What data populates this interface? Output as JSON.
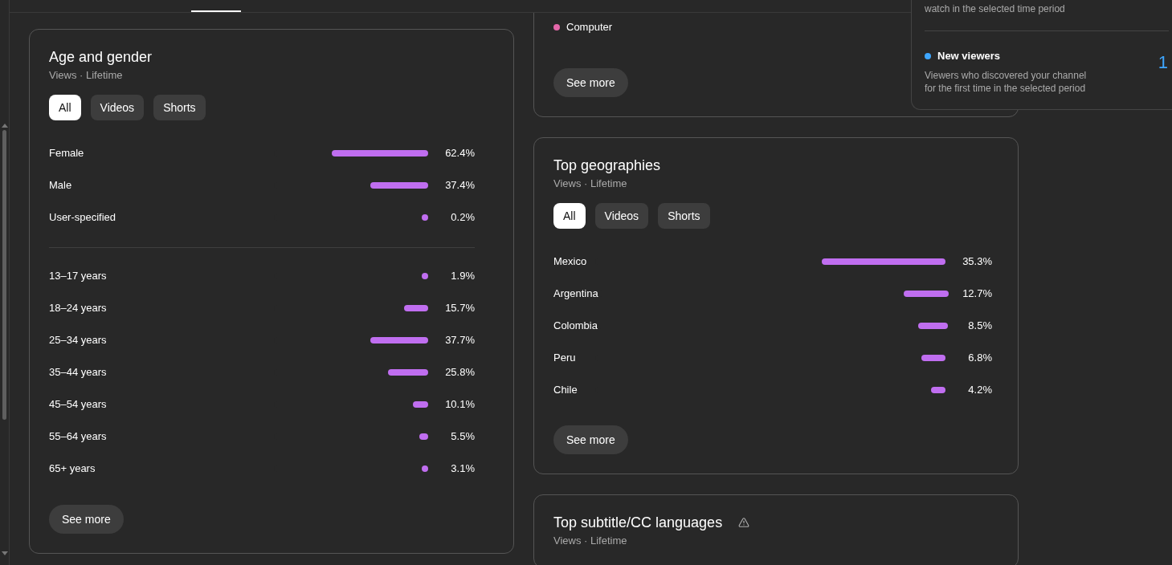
{
  "device_card": {
    "legend": [
      {
        "label": "Computer",
        "color": "#e467a9"
      }
    ],
    "button": "See more"
  },
  "age_gender": {
    "title": "Age and gender",
    "subtitle": "Views · Lifetime",
    "filters": [
      {
        "label": "All",
        "selected": true
      },
      {
        "label": "Videos",
        "selected": false
      },
      {
        "label": "Shorts",
        "selected": false
      }
    ],
    "gender": [
      {
        "label": "Female",
        "value": "62.4%",
        "level": 0.624
      },
      {
        "label": "Male",
        "value": "37.4%",
        "level": 0.374
      },
      {
        "label": "User-specified",
        "value": "0.2%",
        "level": 0.002
      }
    ],
    "age": [
      {
        "label": "13–17 years",
        "value": "1.9%",
        "level": 0.019
      },
      {
        "label": "18–24 years",
        "value": "15.7%",
        "level": 0.157
      },
      {
        "label": "25–34 years",
        "value": "37.7%",
        "level": 0.377
      },
      {
        "label": "35–44 years",
        "value": "25.8%",
        "level": 0.258
      },
      {
        "label": "45–54 years",
        "value": "10.1%",
        "level": 0.101
      },
      {
        "label": "55–64 years",
        "value": "5.5%",
        "level": 0.055
      },
      {
        "label": "65+ years",
        "value": "3.1%",
        "level": 0.031
      }
    ],
    "button": "See more"
  },
  "geographies": {
    "title": "Top geographies",
    "subtitle": "Views · Lifetime",
    "filters": [
      {
        "label": "All",
        "selected": true
      },
      {
        "label": "Videos",
        "selected": false
      },
      {
        "label": "Shorts",
        "selected": false
      }
    ],
    "rows": [
      {
        "label": "Mexico",
        "value": "35.3%",
        "level": 0.353
      },
      {
        "label": "Argentina",
        "value": "12.7%",
        "level": 0.127
      },
      {
        "label": "Colombia",
        "value": "8.5%",
        "level": 0.085
      },
      {
        "label": "Peru",
        "value": "6.8%",
        "level": 0.068
      },
      {
        "label": "Chile",
        "value": "4.2%",
        "level": 0.042
      }
    ],
    "button": "See more"
  },
  "subtitle_languages": {
    "title": "Top subtitle/CC languages",
    "subtitle": "Views · Lifetime"
  },
  "overlay": {
    "items": [
      {
        "description": "watch in the selected time period"
      },
      {
        "title": "New viewers",
        "color": "#3ea6ff",
        "description": "Viewers who discovered your channel\nfor the first time in the selected period",
        "value": "1"
      }
    ]
  }
}
